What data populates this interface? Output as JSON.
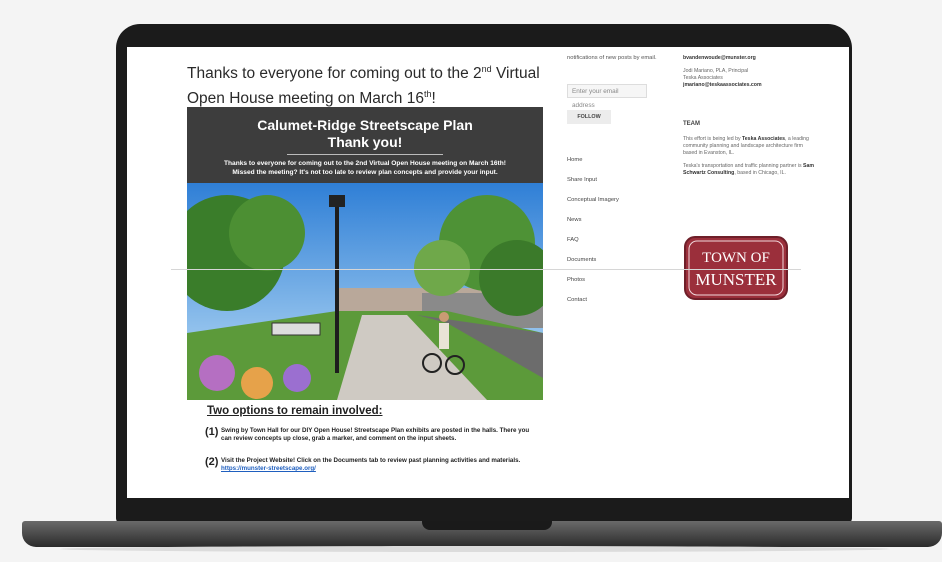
{
  "post": {
    "headline_line1": "Thanks to everyone for coming out to the 2",
    "headline_sup1": "nd",
    "headline_line1_end": " Virtual",
    "headline_line2": "Open House meeting on March 16",
    "headline_sup2": "th",
    "headline_line2_end": "!"
  },
  "poster": {
    "title_line1": "Calumet-Ridge Streetscape Plan",
    "title_line2": "Thank you!",
    "text_line1": "Thanks to everyone for coming out to the 2nd Virtual Open House meeting on March 16th!",
    "text_line2": "Missed the meeting? It's not too late to review plan concepts and provide your input."
  },
  "options": {
    "title": "Two options to remain involved:",
    "item1_num": "(1)",
    "item1_text": "Swing by Town Hall for our DIY Open House! Streetscape Plan exhibits are posted in the halls. There you can review concepts up close, grab a marker, and comment on the input sheets.",
    "item2_num": "(2)",
    "item2_text": "Visit the Project Website! Click on the Documents tab to review past planning activities and materials.",
    "item2_link": "https://munster-streetscape.org/"
  },
  "sidebar": {
    "notify_text": "notifications of new posts by email.",
    "email_placeholder": "Enter your email address",
    "follow_label": "FOLLOW",
    "nav": [
      "Home",
      "Share Input",
      "Conceptual Imagery",
      "News",
      "FAQ",
      "Documents",
      "Photos",
      "Contact"
    ]
  },
  "right": {
    "email1": "bvandenwoude@munster.org",
    "contact_name": "Jodi Mariano, PLA, Principal",
    "contact_org": "Teska Associates",
    "email2": "jmariano@teskaassociates.com",
    "team_heading": "TEAM",
    "team_p1_a": "This effort is being led by ",
    "team_p1_b": "Teska Associates",
    "team_p1_c": ", a leading community planning and landscape architecture firm based in Evanston, IL.",
    "team_p2_a": "Teska's transportation and traffic planning partner is ",
    "team_p2_b": "Sam Schwartz Consulting",
    "team_p2_c": ", based in Chicago, IL."
  },
  "seal": {
    "line1": "TOWN OF",
    "line2": "MUNSTER"
  },
  "colors": {
    "seal_red": "#9b2f3b",
    "link": "#1f5fbf",
    "poster_bg": "#3d3d3d"
  }
}
